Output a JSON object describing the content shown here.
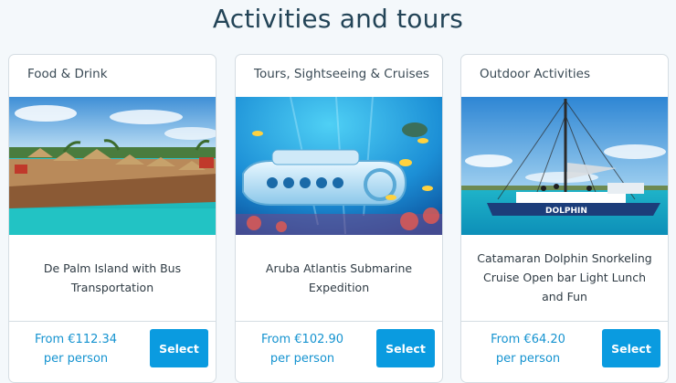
{
  "page": {
    "title": "Activities and tours"
  },
  "cards": [
    {
      "category": "Food & Drink",
      "name": "De Palm Island with Bus Transportation",
      "price_line": "From €112.34",
      "per_line": "per person",
      "button_label": "Select"
    },
    {
      "category": "Tours, Sightseeing & Cruises",
      "name": "Aruba Atlantis Submarine Expedition",
      "price_line": "From €102.90",
      "per_line": "per person",
      "button_label": "Select"
    },
    {
      "category": "Outdoor Activities",
      "name": "Catamaran Dolphin Snorkeling Cruise Open bar Light Lunch and Fun",
      "price_line": "From €64.20",
      "per_line": "per person",
      "button_label": "Select"
    }
  ],
  "colors": {
    "accent": "#0a9be0",
    "price": "#1593d0",
    "title": "#234457",
    "background": "#f4f8fb"
  }
}
